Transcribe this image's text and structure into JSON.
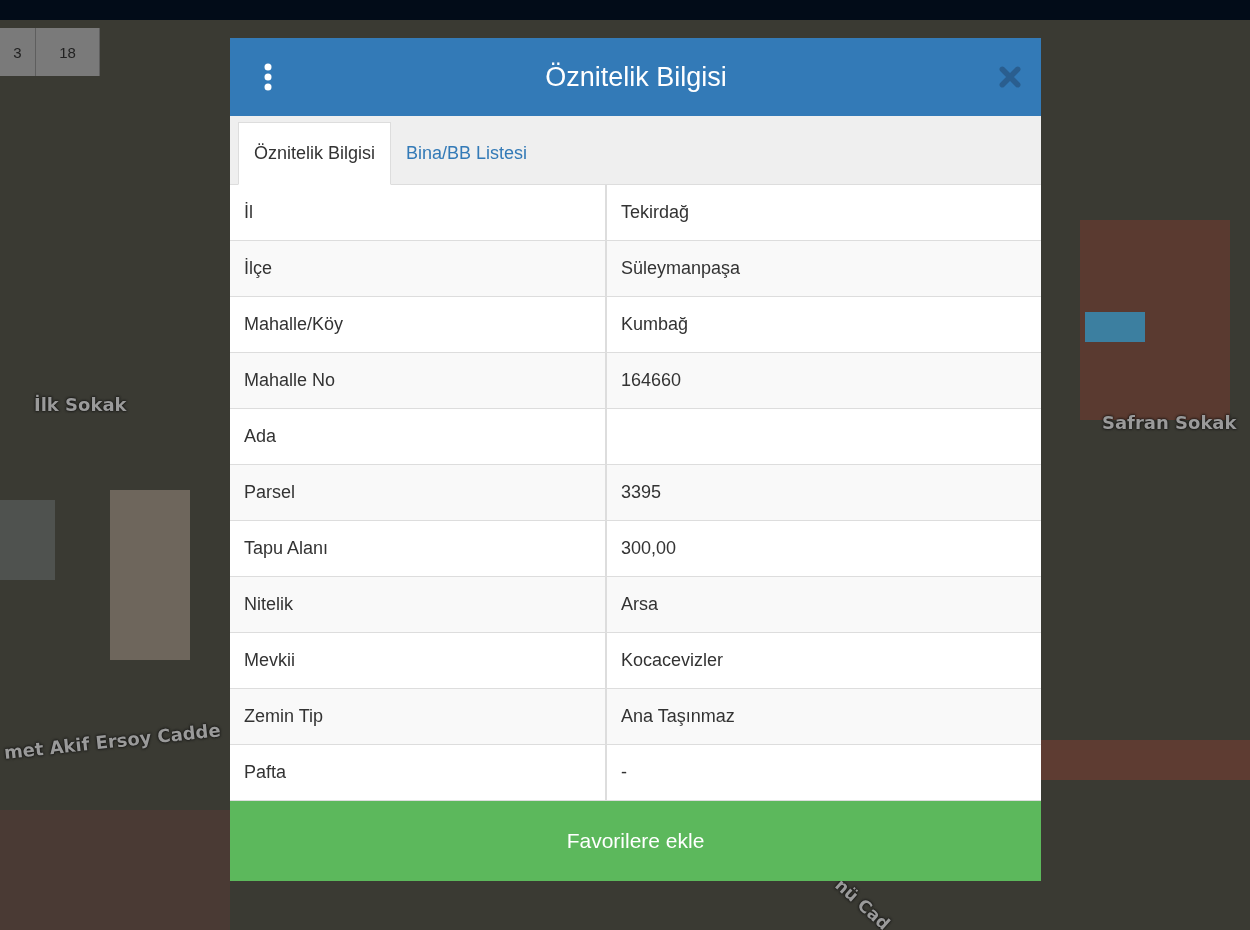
{
  "map": {
    "controls": [
      "3",
      "18"
    ],
    "labels": [
      {
        "text": "İlk Sokak",
        "kind": "flat"
      },
      {
        "text": "met Akif Ersoy Cadde",
        "kind": "tilted"
      },
      {
        "text": "Safran Sokak",
        "kind": "flat"
      },
      {
        "text": "nü Cad",
        "kind": "steep"
      }
    ]
  },
  "dialog": {
    "title": "Öznitelik Bilgisi",
    "tabs": [
      {
        "label": "Öznitelik Bilgisi",
        "selected": true
      },
      {
        "label": "Bina/BB Listesi",
        "selected": false
      }
    ],
    "rows": [
      {
        "label": "İl",
        "value": "Tekirdağ"
      },
      {
        "label": "İlçe",
        "value": "Süleymanpaşa"
      },
      {
        "label": "Mahalle/Köy",
        "value": "Kumbağ"
      },
      {
        "label": "Mahalle No",
        "value": "164660"
      },
      {
        "label": "Ada"
      },
      {
        "label": "Parsel",
        "value": "3395"
      },
      {
        "label": "Tapu Alanı",
        "value": "300,00"
      },
      {
        "label": "Nitelik",
        "value": "Arsa"
      },
      {
        "label": "Mevkii",
        "value": "Kocacevizler"
      },
      {
        "label": "Zemin Tip",
        "value": "Ana Taşınmaz"
      },
      {
        "label": "Pafta",
        "value": "-"
      }
    ],
    "button": "Favorilere ekle"
  }
}
